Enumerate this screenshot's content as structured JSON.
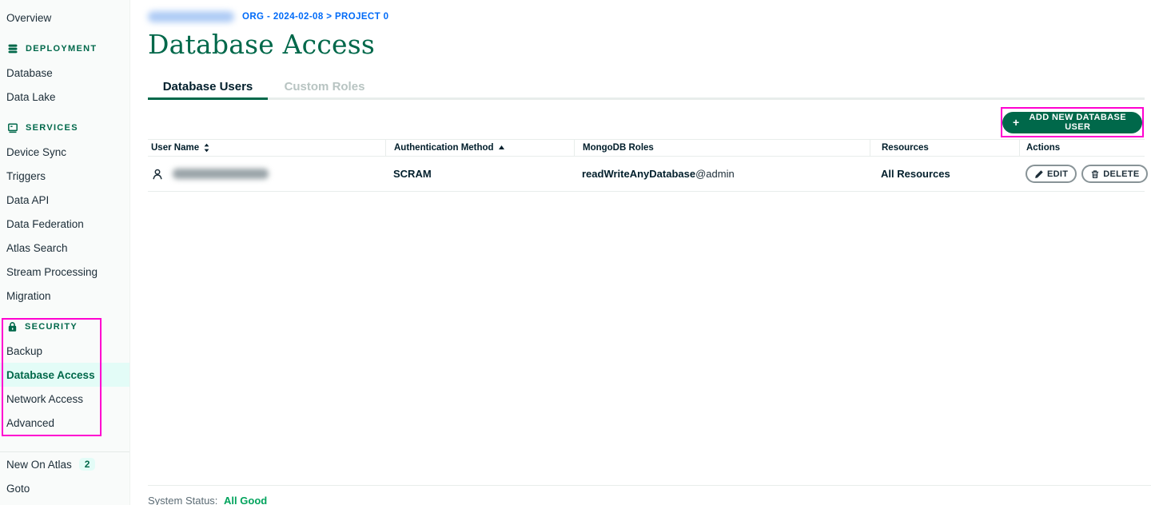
{
  "colors": {
    "brand_green": "#00684A",
    "mint_highlight": "#E3FCF7",
    "breadcrumb_blue": "#016BF8",
    "annotation_magenta": "#FF00D0",
    "status_green": "#00A35C"
  },
  "sidebar": {
    "overview": "Overview",
    "sections": [
      {
        "title": "DEPLOYMENT",
        "icon": "database-stack-icon",
        "items": [
          "Database",
          "Data Lake"
        ]
      },
      {
        "title": "SERVICES",
        "icon": "window-icon",
        "items": [
          "Device Sync",
          "Triggers",
          "Data API",
          "Data Federation",
          "Atlas Search",
          "Stream Processing",
          "Migration"
        ]
      },
      {
        "title": "SECURITY",
        "icon": "lock-icon",
        "items": [
          "Backup",
          "Database Access",
          "Network Access",
          "Advanced"
        ],
        "active_item": "Database Access"
      }
    ],
    "new_on_atlas": "New On Atlas",
    "new_on_atlas_badge": "2",
    "goto": "Goto"
  },
  "header": {
    "breadcrumb": "ORG - 2024-02-08 > PROJECT 0",
    "title": "Database Access"
  },
  "tabs": [
    {
      "label": "Database Users",
      "active": true
    },
    {
      "label": "Custom Roles",
      "active": false
    }
  ],
  "toolbar": {
    "add_button_plus": "+",
    "add_button_label": "ADD NEW DATABASE USER"
  },
  "table": {
    "columns": [
      "User Name",
      "Authentication Method",
      "MongoDB Roles",
      "Resources",
      "Actions"
    ],
    "rows": [
      {
        "auth_method": "SCRAM",
        "role": "readWriteAnyDatabase",
        "role_scope": "@admin",
        "resources": "All Resources",
        "edit": "EDIT",
        "delete": "DELETE"
      }
    ]
  },
  "status_bar": {
    "label": "System Status:",
    "value": "All Good"
  }
}
